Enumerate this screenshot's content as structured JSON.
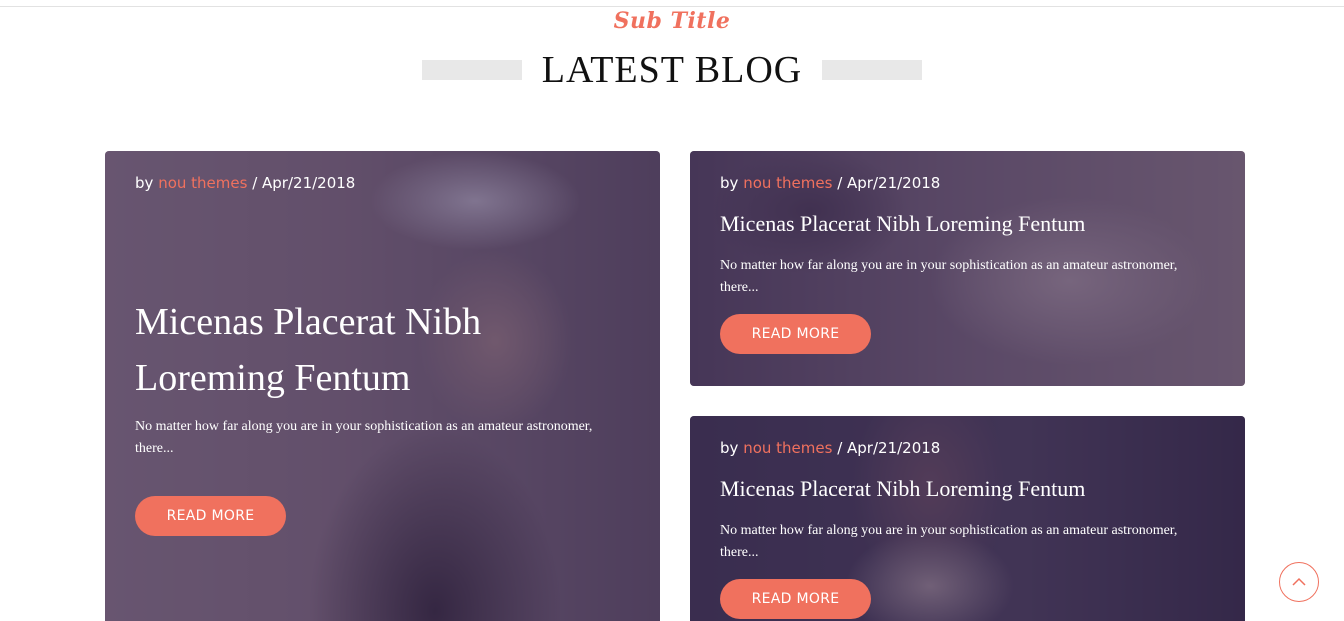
{
  "section": {
    "subtitle": "Sub Title",
    "heading": "LATEST BLOG"
  },
  "posts": [
    {
      "by": "by",
      "author": "nou themes",
      "separator": " / ",
      "date": "Apr/21/2018",
      "title": "Micenas Placerat Nibh Loreming Fentum",
      "excerpt": "No matter how far along you are in your sophistication as an amateur astronomer, there...",
      "button": "READ MORE"
    },
    {
      "by": "by",
      "author": "nou themes",
      "separator": " / ",
      "date": "Apr/21/2018",
      "title": "Micenas Placerat Nibh Loreming Fentum",
      "excerpt": "No matter how far along you are in your sophistication as an amateur astronomer, there...",
      "button": "READ MORE"
    },
    {
      "by": "by",
      "author": "nou themes",
      "separator": " / ",
      "date": "Apr/21/2018",
      "title": "Micenas Placerat Nibh Loreming Fentum",
      "excerpt": "No matter how far along you are in your sophistication as an amateur astronomer, there...",
      "button": "READ MORE"
    }
  ],
  "colors": {
    "accent": "#f0715e",
    "overlay": "#3a2a58",
    "heading": "#111111"
  },
  "icons": {
    "scroll_top": "chevron-up-icon"
  }
}
